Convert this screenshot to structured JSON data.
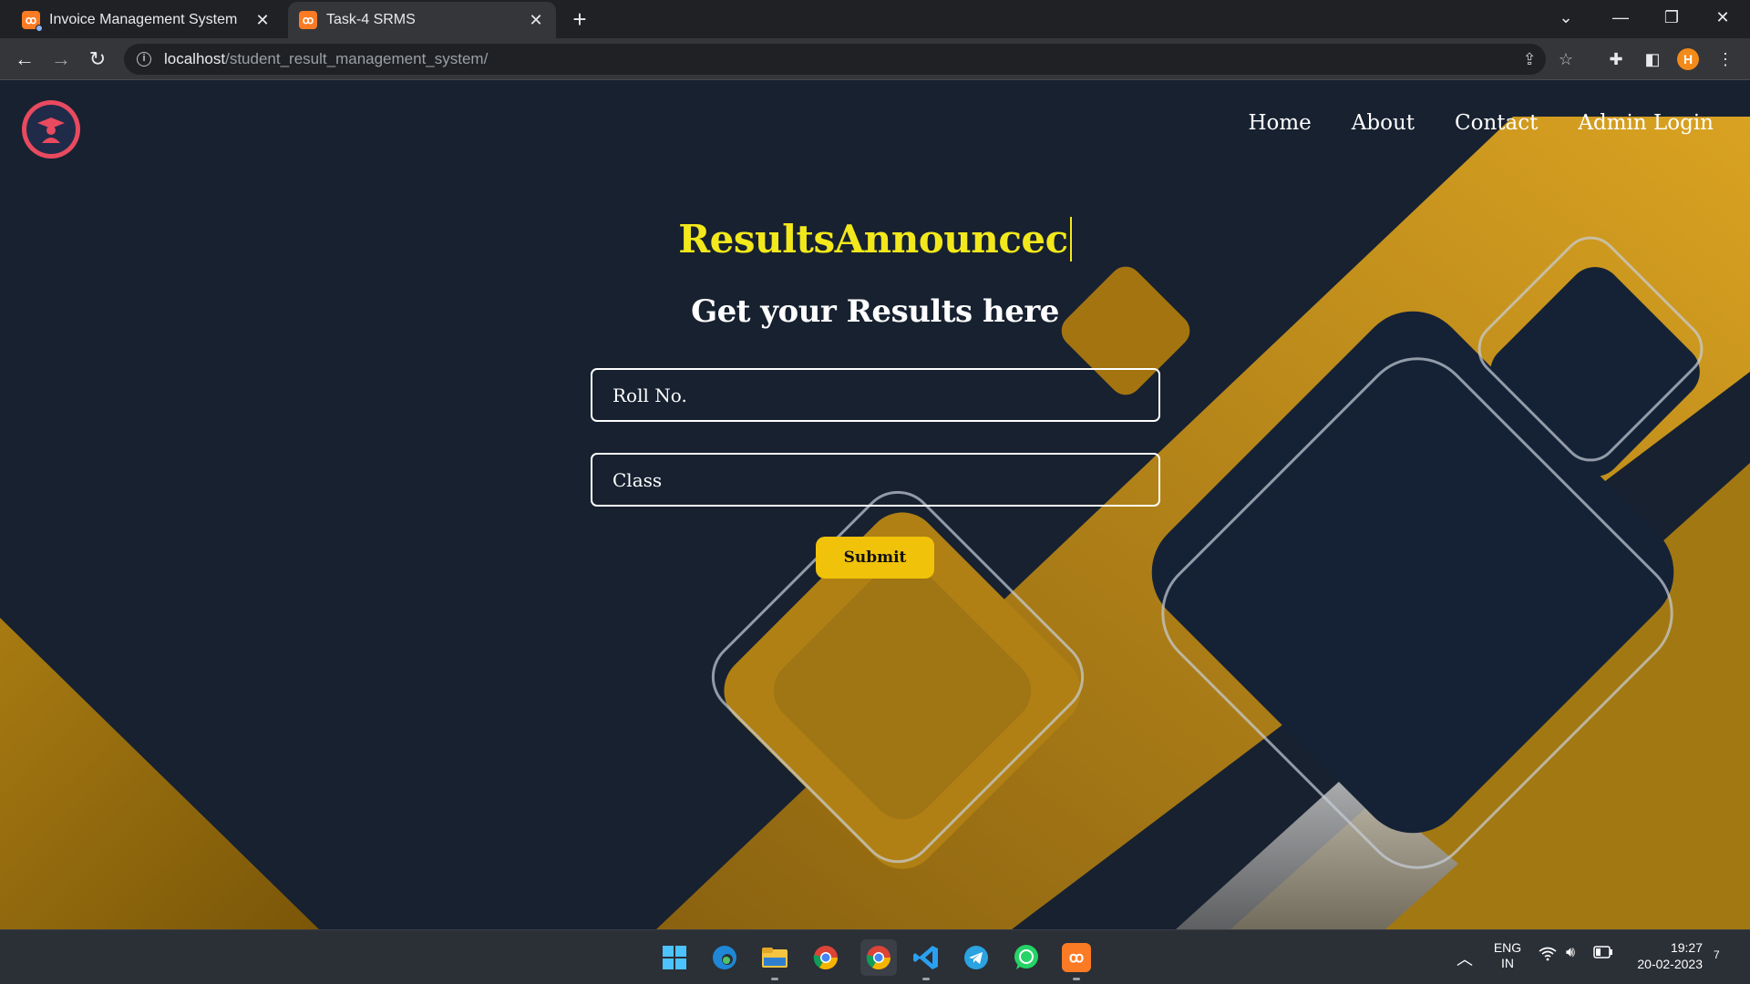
{
  "browser": {
    "tabs": [
      {
        "title": "Invoice Management System",
        "icon": "xampp-icon",
        "active": false
      },
      {
        "title": "Task-4 SRMS",
        "icon": "xampp-icon",
        "active": true
      }
    ],
    "url_host": "localhost",
    "url_path": "/student_result_management_system/",
    "profile_initial": "H"
  },
  "page": {
    "nav": [
      "Home",
      "About",
      "Contact",
      "Admin Login"
    ],
    "headline": "ResultsAnnouncec",
    "subheading": "Get your Results here",
    "form": {
      "roll_placeholder": "Roll No.",
      "class_placeholder": "Class",
      "submit_label": "Submit"
    },
    "colors": {
      "background": "#172130",
      "accent": "#e8b21a",
      "headline": "#f3e81b",
      "button": "#f0c20a"
    }
  },
  "taskbar": {
    "language": "ENG",
    "region": "IN",
    "time": "19:27",
    "date": "20-02-2023",
    "notification_count": "7"
  }
}
